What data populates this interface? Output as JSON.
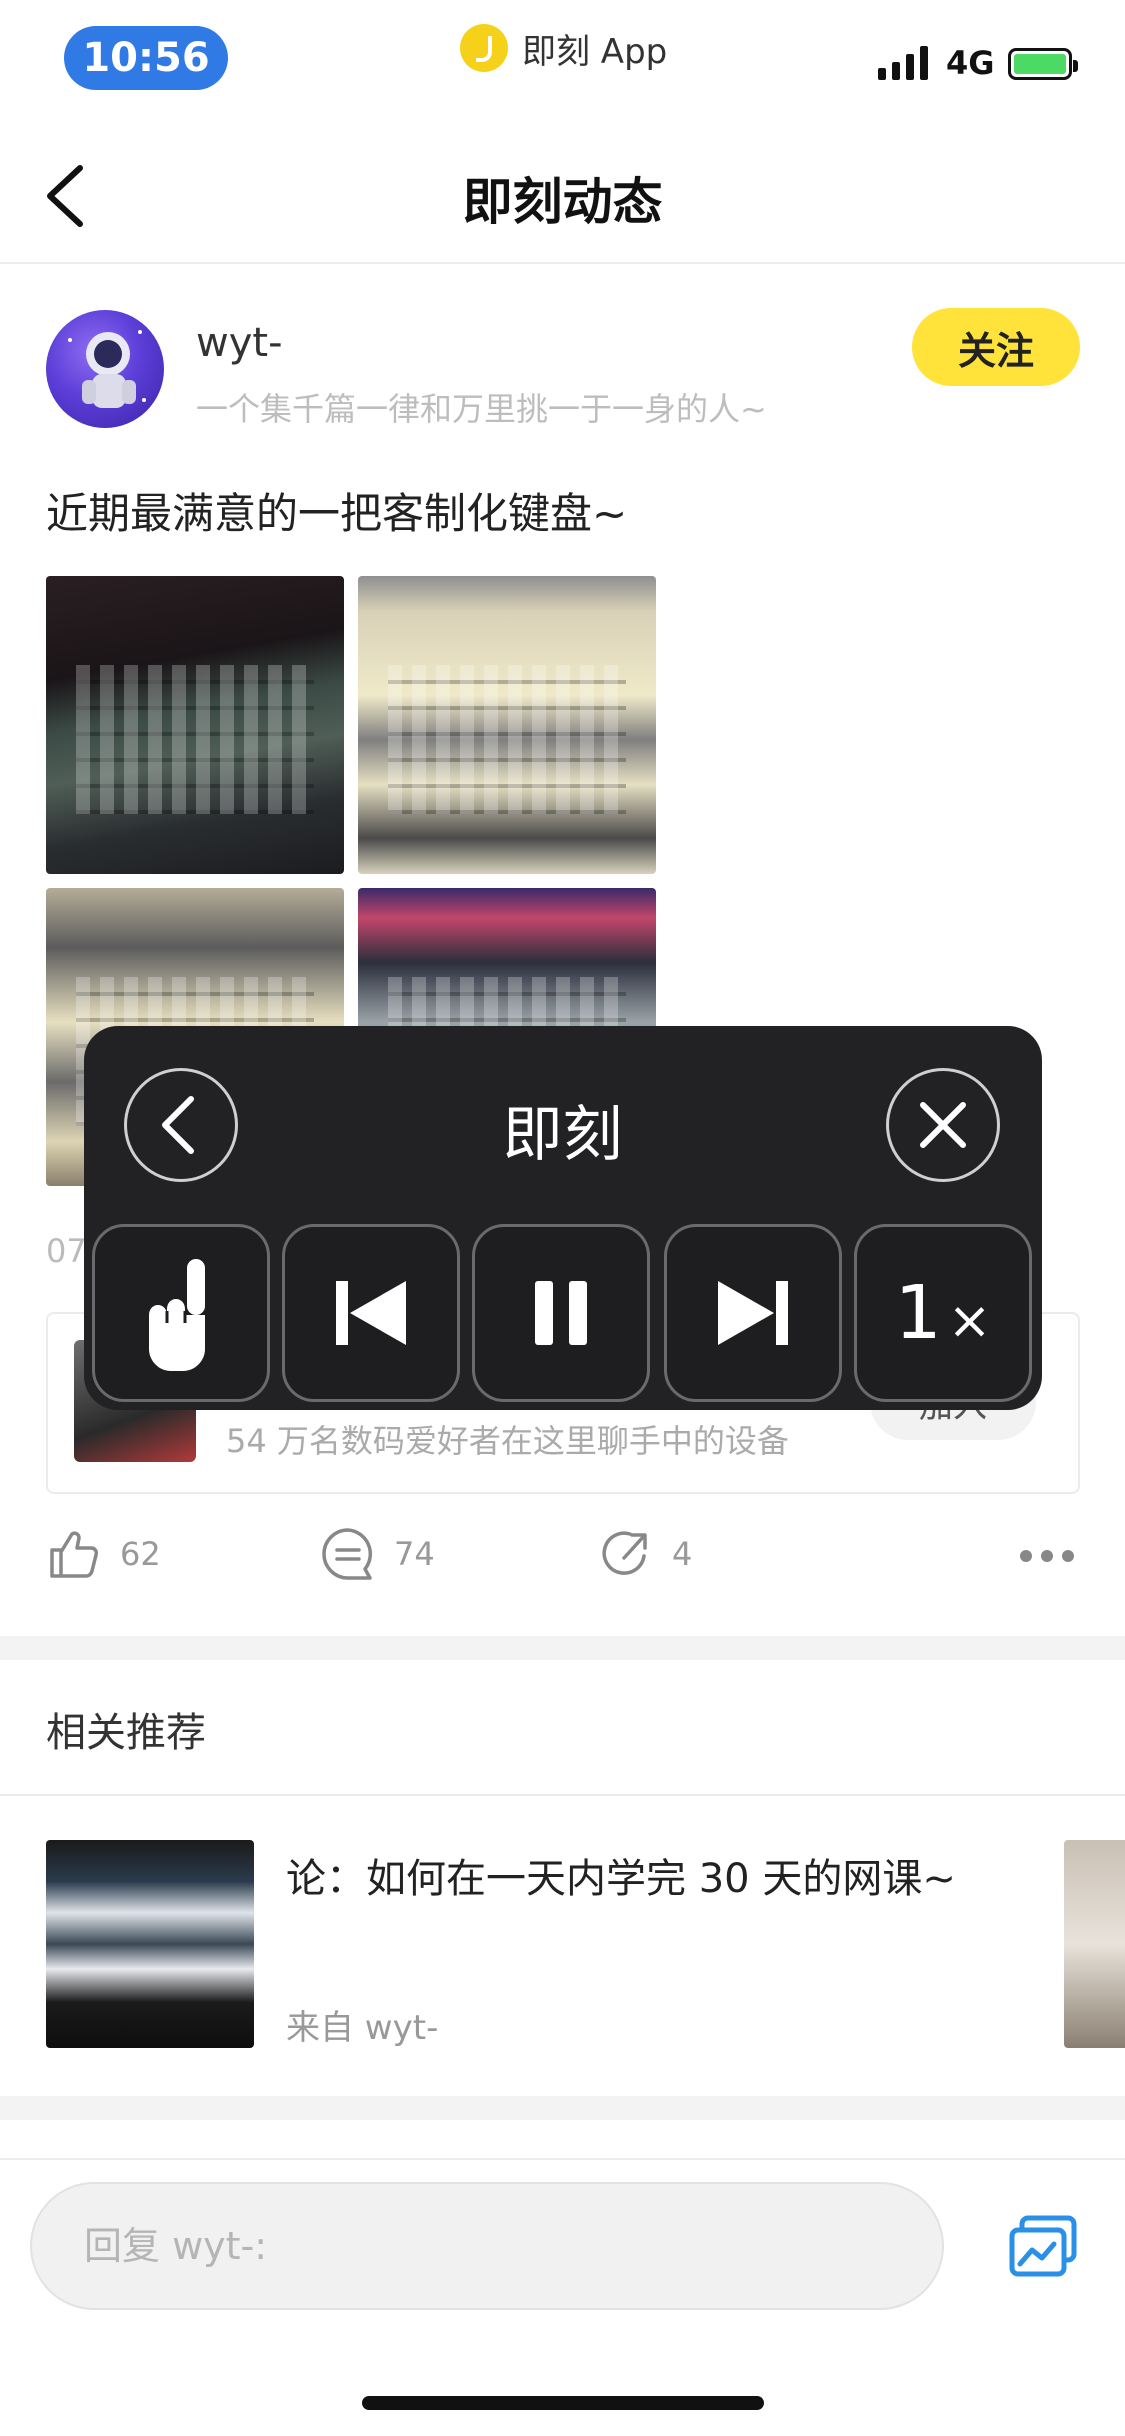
{
  "status_bar": {
    "time": "10:56",
    "app_indicator": "即刻 App",
    "network": "4G",
    "signal_icon": "cellular-signal-icon",
    "battery_icon": "battery-charging-icon"
  },
  "nav": {
    "title": "即刻动态",
    "back_icon": "chevron-left-icon"
  },
  "post": {
    "author_name": "wyt-",
    "author_bio": "一个集千篇一律和万里挑一于一身的人~",
    "follow_label": "关注",
    "text": "近期最满意的一把客制化键盘~",
    "date_partial": "07",
    "community": {
      "description": "54 万名数码爱好者在这里聊手中的设备",
      "join_label": "加入"
    },
    "actions": {
      "like_count": "62",
      "comment_count": "74",
      "share_count": "4"
    }
  },
  "recommend": {
    "section_title": "相关推荐",
    "items": [
      {
        "title": "论：如何在一天内学完 30 天的网课~",
        "from": "来自 wyt-"
      }
    ]
  },
  "reply": {
    "placeholder": "回复 wyt-:"
  },
  "player": {
    "title": "即刻",
    "speed_value": "1",
    "speed_unit": "×",
    "buttons": [
      "tap-gesture-icon",
      "skip-previous-icon",
      "pause-icon",
      "skip-next-icon"
    ]
  },
  "colors": {
    "accent_yellow": "#ffe33a",
    "time_pill_blue": "#2f7ae5",
    "image_button_blue": "#2a8fe6",
    "player_background": "#222225"
  }
}
